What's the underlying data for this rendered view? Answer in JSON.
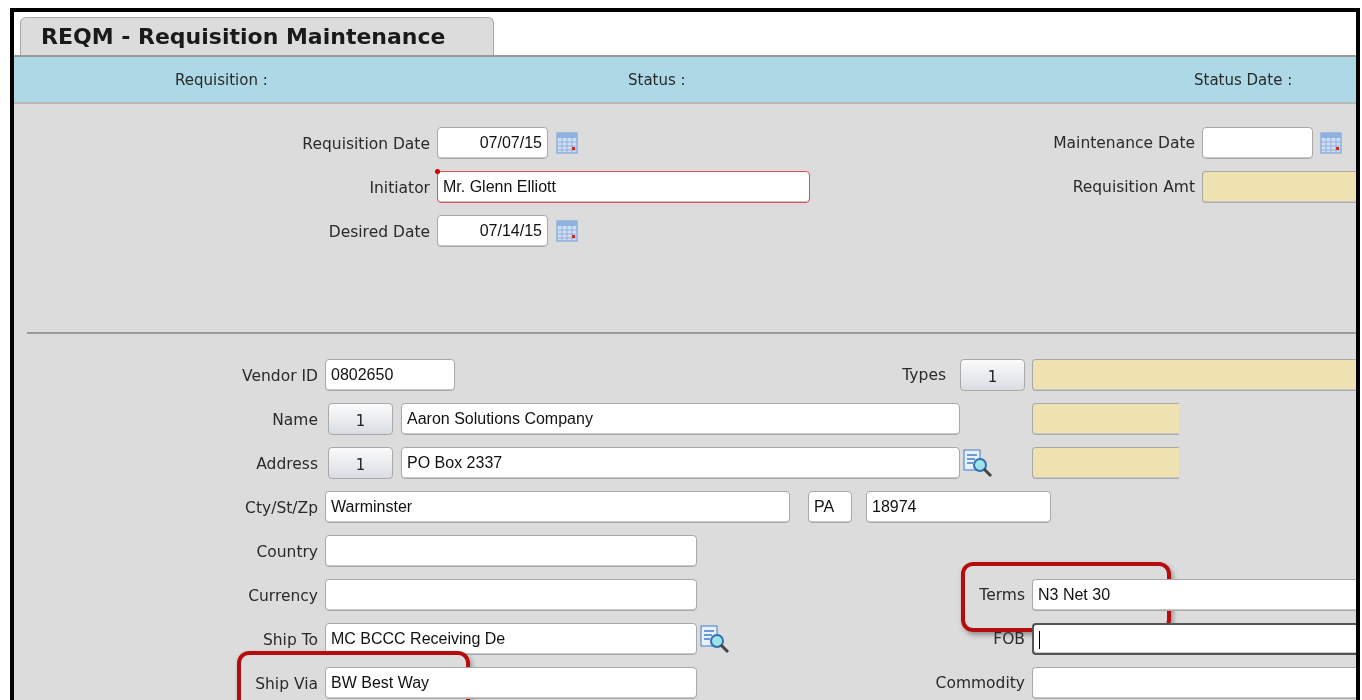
{
  "tab": {
    "label": "REQM - Requisition Maintenance",
    "selected": true
  },
  "header_bar": [
    {
      "label": "Requisition :"
    },
    {
      "label": "Status :"
    },
    {
      "label": "Status Date :"
    }
  ],
  "header": [
    {
      "left": {
        "label": "Requisition Date",
        "highlighted": false,
        "controls": [
          {
            "kind": "date",
            "value": "07/07/15"
          },
          {
            "kind": "calendar"
          }
        ]
      },
      "right": {
        "label": "Maintenance Date",
        "highlighted": false,
        "controls": [
          {
            "kind": "date"
          },
          {
            "kind": "calendar"
          }
        ]
      }
    },
    {
      "left": {
        "label": "Initiator",
        "highlighted": false,
        "controls": [
          {
            "kind": "wide",
            "value": "Mr. Glenn Elliott",
            "required": true
          }
        ]
      },
      "right": {
        "label": "Requisition Amt",
        "highlighted": false,
        "controls": [
          {
            "kind": "readonly"
          }
        ]
      }
    },
    {
      "left": {
        "label": "Desired Date",
        "highlighted": false,
        "controls": [
          {
            "kind": "date",
            "value": "07/14/15"
          },
          {
            "kind": "calendar"
          }
        ]
      }
    }
  ],
  "vendor": [
    {
      "left": {
        "label": "Vendor ID",
        "highlighted": false,
        "controls": [
          {
            "kind": "id",
            "value": "0802650"
          }
        ]
      },
      "right": {
        "label": "Types",
        "highlighted": false,
        "controls": [
          {
            "kind": "lookup",
            "value": "1"
          },
          {
            "kind": "readonly"
          }
        ]
      }
    },
    {
      "left": {
        "label": "Name",
        "highlighted": false,
        "controls": [
          {
            "kind": "lookup",
            "value": "1"
          },
          {
            "kind": "name",
            "value": "Aaron Solutions Company"
          }
        ]
      },
      "right": {
        "highlighted": false,
        "controls": [
          {
            "kind": "readonly-short"
          }
        ]
      }
    },
    {
      "left": {
        "label": "Address",
        "highlighted": false,
        "controls": [
          {
            "kind": "lookup",
            "value": "1"
          },
          {
            "kind": "name",
            "value": "PO Box 2337"
          },
          {
            "kind": "search"
          }
        ]
      },
      "right": {
        "highlighted": false,
        "controls": [
          {
            "kind": "readonly-short"
          }
        ]
      }
    },
    {
      "left": {
        "label": "Cty/St/Zp",
        "highlighted": false,
        "controls": [
          {
            "kind": "city",
            "value": "Warminster"
          },
          {
            "kind": "state",
            "value": "PA"
          },
          {
            "kind": "zip",
            "value": "18974"
          }
        ]
      }
    },
    {
      "left": {
        "label": "Country",
        "highlighted": false,
        "controls": [
          {
            "kind": "medium"
          }
        ]
      }
    },
    {
      "left": {
        "label": "Currency",
        "highlighted": false,
        "controls": [
          {
            "kind": "medium"
          }
        ]
      },
      "right": {
        "label": "Terms",
        "highlighted": true,
        "controls": [
          {
            "kind": "field",
            "value": "N3 Net 30"
          }
        ]
      }
    },
    {
      "left": {
        "label": "Ship To",
        "highlighted": false,
        "controls": [
          {
            "kind": "medium",
            "value": "MC BCCC Receiving De"
          },
          {
            "kind": "search"
          }
        ]
      },
      "right": {
        "label": "FOB",
        "highlighted": false,
        "controls": [
          {
            "kind": "field",
            "focused": true
          }
        ]
      }
    },
    {
      "left": {
        "label": "Ship Via",
        "highlighted": true,
        "controls": [
          {
            "kind": "medium",
            "value": "BW Best Way"
          }
        ]
      },
      "right": {
        "label": "Commodity",
        "highlighted": false,
        "controls": [
          {
            "kind": "field"
          }
        ]
      }
    }
  ]
}
